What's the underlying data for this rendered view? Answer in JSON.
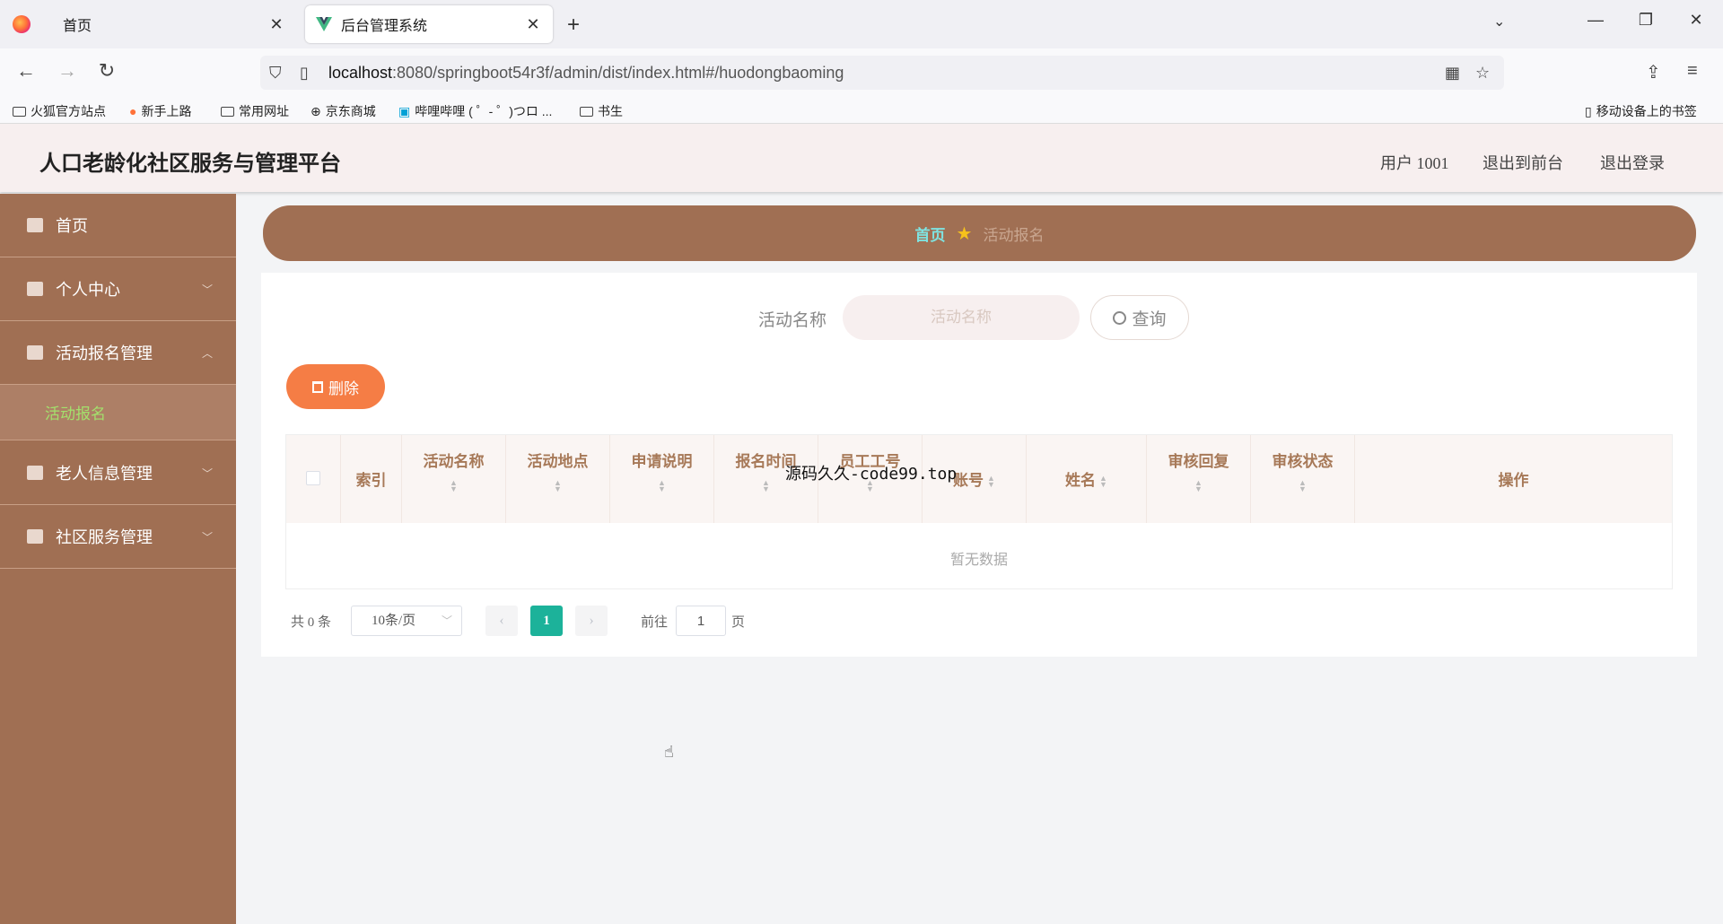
{
  "browser": {
    "tabs": [
      {
        "title": "首页",
        "active": false
      },
      {
        "title": "后台管理系统",
        "active": true
      }
    ],
    "url_host": "localhost",
    "url_rest": ":8080/springboot54r3f/admin/dist/index.html#/huodongbaoming",
    "bookmarks": [
      "火狐官方站点",
      "新手上路",
      "常用网址",
      "京东商城",
      "哔哩哔哩 ( ゜- ゜)つロ ...",
      "书生"
    ],
    "mobile_bookmarks": "移动设备上的书签"
  },
  "header": {
    "title": "人口老龄化社区服务与管理平台",
    "user": "用户 1001",
    "to_front": "退出到前台",
    "logout": "退出登录"
  },
  "sidebar": {
    "items": [
      {
        "label": "首页"
      },
      {
        "label": "个人中心"
      },
      {
        "label": "活动报名管理"
      },
      {
        "label": "老人信息管理"
      },
      {
        "label": "社区服务管理"
      }
    ],
    "active_sub": "活动报名"
  },
  "breadcrumb": {
    "home": "首页",
    "current": "活动报名"
  },
  "search": {
    "label": "活动名称",
    "placeholder": "活动名称",
    "button": "查询"
  },
  "actions": {
    "delete": "删除"
  },
  "table": {
    "columns": [
      "索引",
      "活动名称",
      "活动地点",
      "申请说明",
      "报名时间",
      "员工工号",
      "账号",
      "姓名",
      "审核回复",
      "审核状态",
      "操作"
    ],
    "empty": "暂无数据"
  },
  "pagination": {
    "total": "共 0 条",
    "page_size": "10条/页",
    "current_page": "1",
    "goto_label": "前往",
    "goto_value": "1",
    "goto_suffix": "页"
  },
  "overlay": "源码久久-code99.top",
  "colors": {
    "sidebar": "#a06f53",
    "accent_green": "#1cb29a",
    "delete_orange": "#f57d45"
  }
}
